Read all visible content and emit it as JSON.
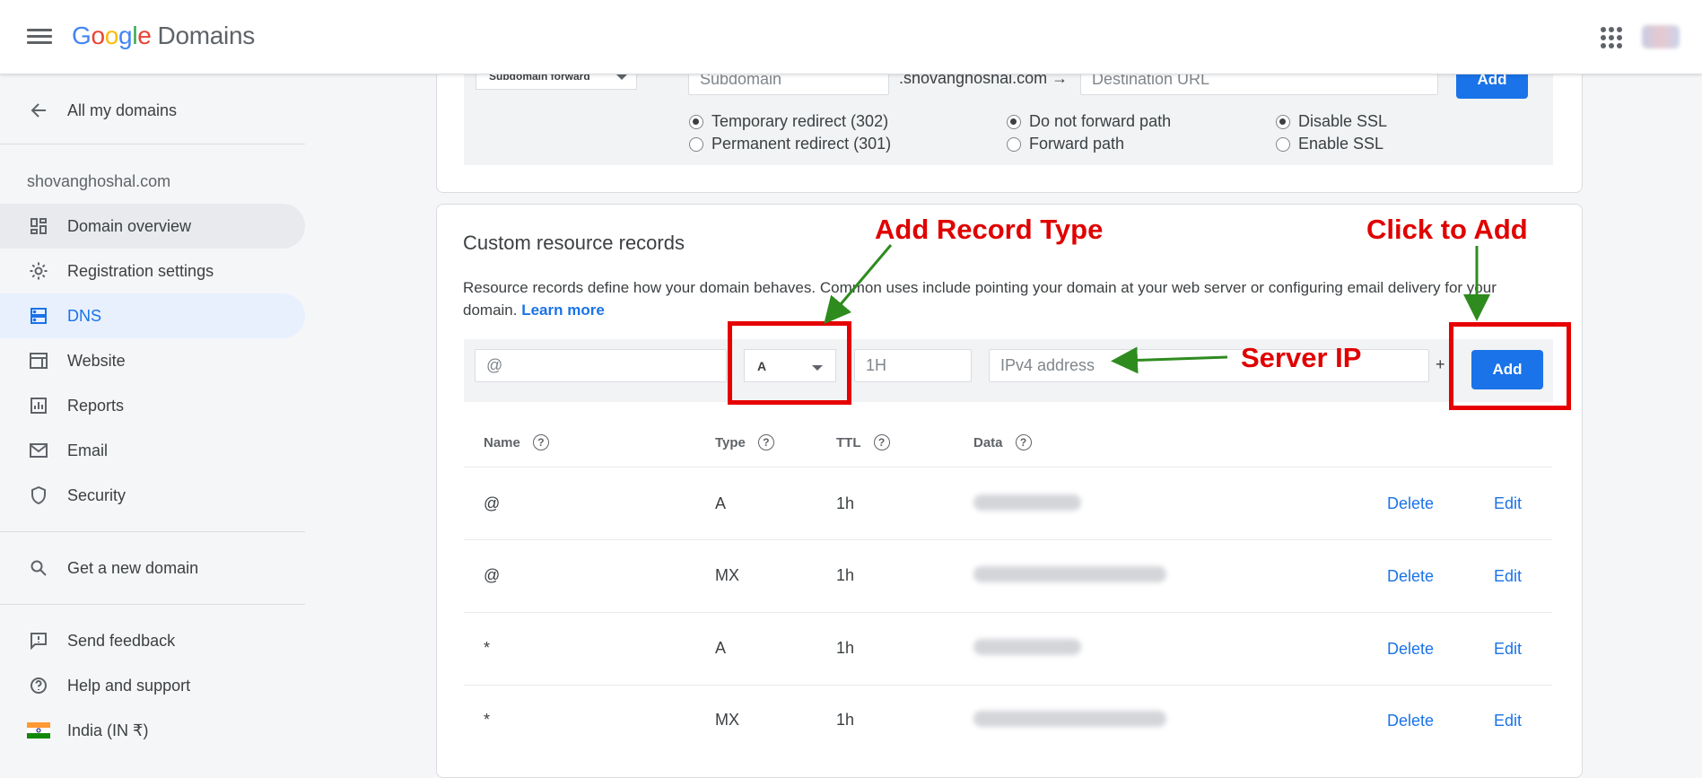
{
  "app": {
    "google": "Google",
    "product": "Domains"
  },
  "sidebar": {
    "back_label": "All my domains",
    "domain": "shovanghoshal.com",
    "items": [
      {
        "label": "Domain overview",
        "icon": "dashboard-icon"
      },
      {
        "label": "Registration settings",
        "icon": "gear-icon"
      },
      {
        "label": "DNS",
        "icon": "dns-icon"
      },
      {
        "label": "Website",
        "icon": "website-icon"
      },
      {
        "label": "Reports",
        "icon": "reports-icon"
      },
      {
        "label": "Email",
        "icon": "email-icon"
      },
      {
        "label": "Security",
        "icon": "shield-icon"
      }
    ],
    "get_domain": "Get a new domain",
    "feedback": "Send feedback",
    "help": "Help and support",
    "locale": "India (IN ₹)"
  },
  "forward": {
    "dropdown": "Subdomain forward",
    "subdomain_placeholder": "Subdomain",
    "domain_suffix": ".shovanghoshal.com →",
    "destination_placeholder": "Destination URL",
    "add": "Add",
    "radios": {
      "temp": "Temporary redirect (302)",
      "perm": "Permanent redirect (301)",
      "no_path": "Do not forward path",
      "path": "Forward path",
      "disable_ssl": "Disable SSL",
      "enable_ssl": "Enable SSL"
    }
  },
  "records": {
    "title": "Custom resource records",
    "description": "Resource records define how your domain behaves. Common uses include pointing your domain at your web server or configuring email delivery for your domain.",
    "learn_more": "Learn more",
    "name_value": "@",
    "type_value": "A",
    "ttl_placeholder": "1H",
    "data_placeholder": "IPv4 address",
    "plus": "+",
    "add": "Add",
    "headers": {
      "name": "Name",
      "type": "Type",
      "ttl": "TTL",
      "data": "Data"
    },
    "rows": [
      {
        "name": "@",
        "type": "A",
        "ttl": "1h",
        "delete": "Delete",
        "edit": "Edit"
      },
      {
        "name": "@",
        "type": "MX",
        "ttl": "1h",
        "delete": "Delete",
        "edit": "Edit"
      },
      {
        "name": "*",
        "type": "A",
        "ttl": "1h",
        "delete": "Delete",
        "edit": "Edit"
      },
      {
        "name": "*",
        "type": "MX",
        "ttl": "1h",
        "delete": "Delete",
        "edit": "Edit"
      }
    ]
  },
  "annotations": {
    "record_type": "Add Record Type",
    "click_add": "Click to Add",
    "server_ip": "Server IP",
    "colors": {
      "text": "#e00000",
      "box": "#e60000",
      "arrow": "#2e8b1e"
    }
  }
}
